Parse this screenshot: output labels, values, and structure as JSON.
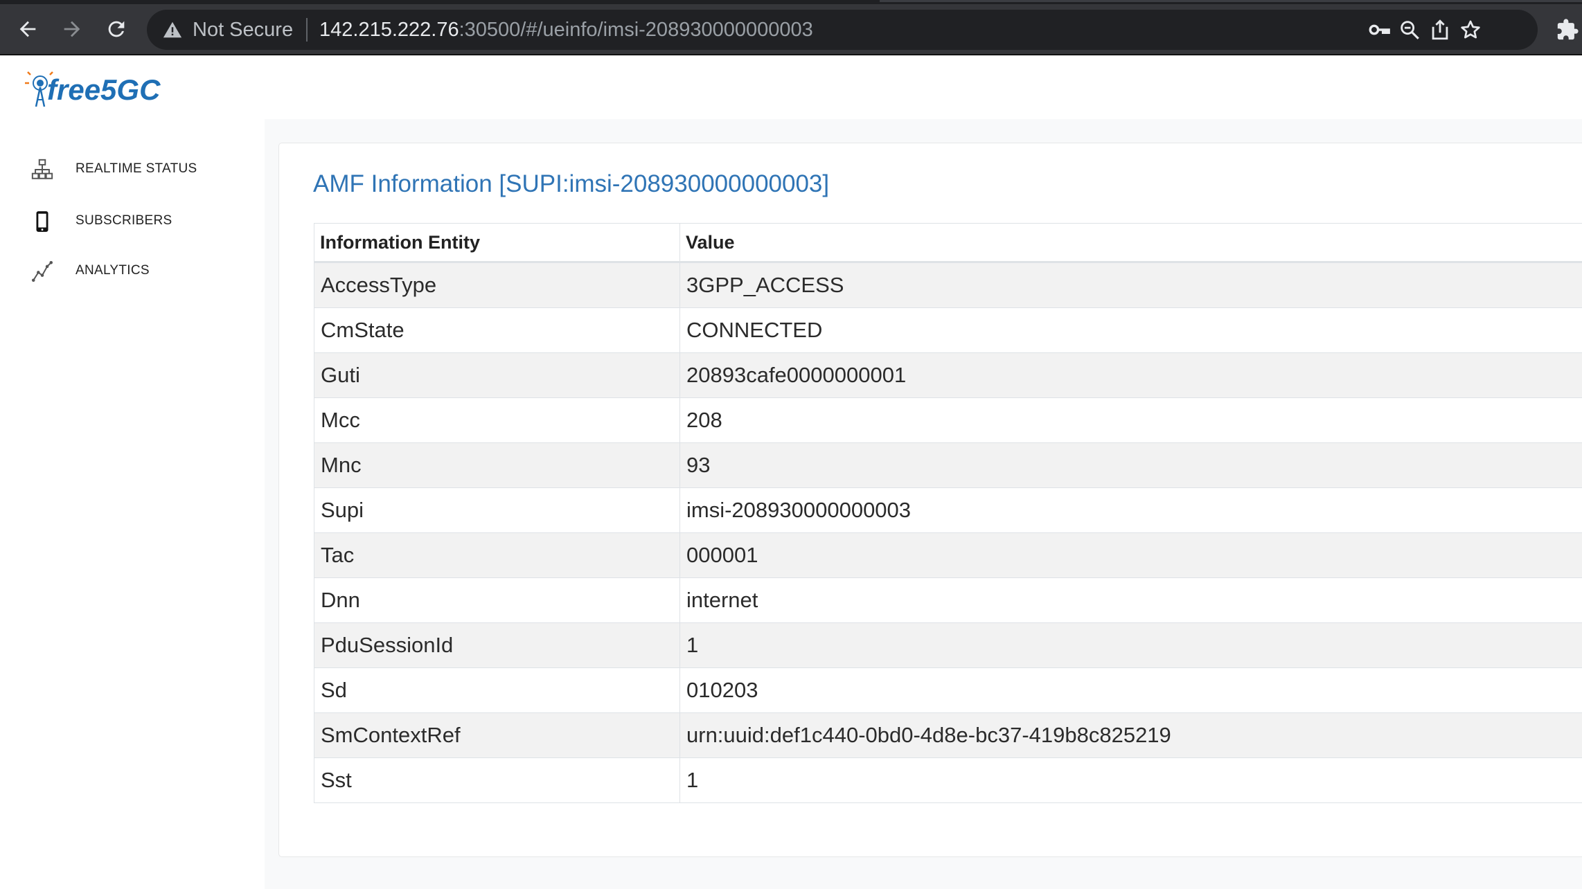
{
  "browser": {
    "security_label": "Not Secure",
    "url_host": "142.215.222.76",
    "url_path": ":30500/#/ueinfo/imsi-208930000000003"
  },
  "app": {
    "logo_text": "free5GC"
  },
  "sidebar": {
    "items": [
      {
        "label": "REALTIME STATUS",
        "icon": "network-icon"
      },
      {
        "label": "SUBSCRIBERS",
        "icon": "phone-icon"
      },
      {
        "label": "ANALYTICS",
        "icon": "line-chart-icon"
      }
    ]
  },
  "main": {
    "title": "AMF Information [SUPI:imsi-208930000000003]",
    "table": {
      "headers": [
        "Information Entity",
        "Value"
      ],
      "rows": [
        {
          "entity": "AccessType",
          "value": "3GPP_ACCESS"
        },
        {
          "entity": "CmState",
          "value": "CONNECTED"
        },
        {
          "entity": "Guti",
          "value": "20893cafe0000000001"
        },
        {
          "entity": "Mcc",
          "value": "208"
        },
        {
          "entity": "Mnc",
          "value": "93"
        },
        {
          "entity": "Supi",
          "value": "imsi-208930000000003"
        },
        {
          "entity": "Tac",
          "value": "000001"
        },
        {
          "entity": "Dnn",
          "value": "internet"
        },
        {
          "entity": "PduSessionId",
          "value": "1"
        },
        {
          "entity": "Sd",
          "value": "010203"
        },
        {
          "entity": "SmContextRef",
          "value": "urn:uuid:def1c440-0bd0-4d8e-bc37-419b8c825219"
        },
        {
          "entity": "Sst",
          "value": "1"
        }
      ]
    }
  },
  "colors": {
    "title_blue": "#2f74b5",
    "logo_blue": "#1f6fb5",
    "logo_orange": "#f07a1a"
  }
}
